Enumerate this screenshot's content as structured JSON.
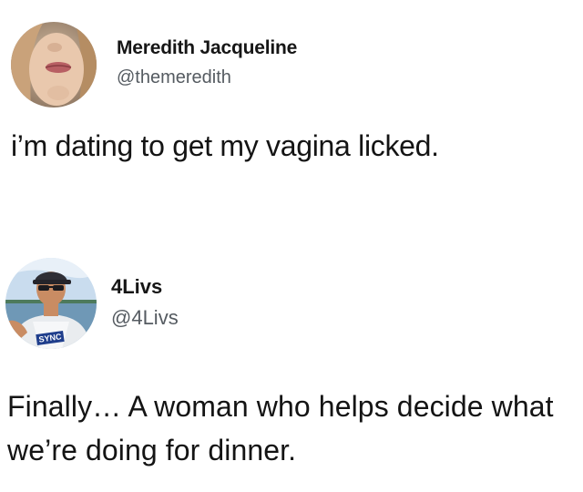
{
  "tweets": [
    {
      "display_name": "Meredith Jacqueline",
      "handle": "@themeredith",
      "text": "i’m dating to get my vagina licked.",
      "avatar_icon": "profile-photo-woman"
    },
    {
      "display_name": "4Livs",
      "handle": "@4Livs",
      "text": "Finally… A woman who helps decide what we’re doing for dinner.",
      "avatar_icon": "profile-photo-man",
      "avatar_shirt_text": "SYNC"
    }
  ]
}
